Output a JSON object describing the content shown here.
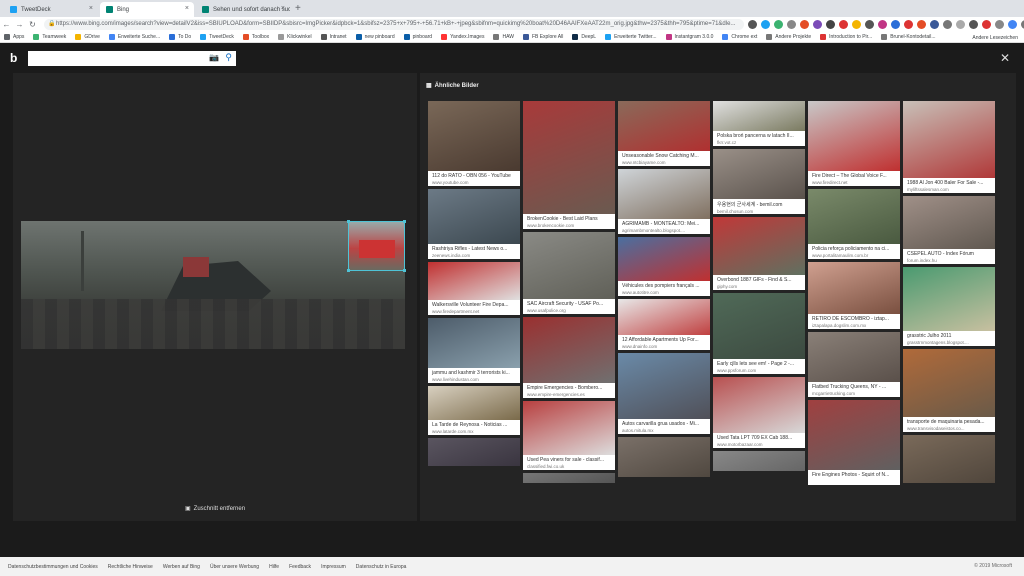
{
  "browser": {
    "tabs": [
      {
        "title": "TweetDeck",
        "color": "#1da1f2",
        "active": false
      },
      {
        "title": "Bing",
        "color": "#008373",
        "active": true
      },
      {
        "title": "Sehen und sofort danach suche...",
        "color": "#008373",
        "active": false
      }
    ],
    "url": "https://www.bing.com/images/search?view=detailV2&iss=SBIUPLOAD&form=SBIIDP&sbisrc=ImgPicker&idpbck=1&sbifsz=2375+x+795+-+56.71+kB+-+jpeg&sbifnm=quickimg%20boat%20D46AAIFXeAAT22m_orig.jpg&thw=2375&thh=795&ptime=71&dle...",
    "bookmarks": [
      {
        "label": "Apps",
        "color": "#5f6368"
      },
      {
        "label": "Teamweek",
        "color": "#3cb371"
      },
      {
        "label": "GDrive",
        "color": "#f4b400"
      },
      {
        "label": "Erweiterte Suche...",
        "color": "#4285f4"
      },
      {
        "label": "To Do",
        "color": "#2a6ed8"
      },
      {
        "label": "TweetDeck",
        "color": "#1da1f2"
      },
      {
        "label": "Toolbox",
        "color": "#e44d26"
      },
      {
        "label": "Klickwinkel",
        "color": "#999999"
      },
      {
        "label": "Intranet",
        "color": "#555555"
      },
      {
        "label": "new pinboard",
        "color": "#0a5ea8"
      },
      {
        "label": "pinboard",
        "color": "#0a5ea8"
      },
      {
        "label": "Yandex.Images",
        "color": "#ff3333"
      },
      {
        "label": "HAW",
        "color": "#777777"
      },
      {
        "label": "FB Explore All",
        "color": "#3b5998"
      },
      {
        "label": "DeepL",
        "color": "#0f2b46"
      },
      {
        "label": "Erweiterte Twitter...",
        "color": "#1da1f2"
      },
      {
        "label": "Instantgram 3.0.0",
        "color": "#c13584"
      },
      {
        "label": "Chrome ext",
        "color": "#4285f4"
      },
      {
        "label": "Andere Projekte",
        "color": "#777777"
      },
      {
        "label": "Introduction to Pir...",
        "color": "#d33"
      },
      {
        "label": "Brunel-Kontodetail...",
        "color": "#777777"
      }
    ],
    "bookmarks_other": "Andere Lesezeichen"
  },
  "bing": {
    "logo": "b",
    "search_value": "",
    "similar_title": "Ähnliche Bilder",
    "remove_crop": "Zuschnitt entfernen"
  },
  "columns": [
    {
      "cards": [
        {
          "caption": "112 do RATO - OBN 056 - YouTube",
          "source": "www.youtube.com",
          "thumb": [
            "#7a6858",
            "#4a3a30"
          ],
          "h": 70
        },
        {
          "caption": "Rashtriya Rifles - Latest News o...",
          "source": "zeenews.india.com",
          "thumb": [
            "#6c7a86",
            "#3c4850"
          ],
          "h": 55
        },
        {
          "caption": "Walkersville Volunteer Fire Depa...",
          "source": "www.firedepartment.net",
          "thumb": [
            "#c03030",
            "#e0e0e0"
          ],
          "h": 38
        },
        {
          "caption": "jammu and kashmir 3 terrorists ki...",
          "source": "www.livehindustan.com",
          "thumb": [
            "#4d5c6a",
            "#8aa0ad"
          ],
          "h": 50
        },
        {
          "caption": "La Tarde de Reynosa - Noticias ...",
          "source": "www.latarde.com.mx",
          "thumb": [
            "#d8d0c0",
            "#7a6a4a"
          ],
          "h": 34
        },
        {
          "caption": "",
          "source": "",
          "thumb": [
            "#5a5560",
            "#3a3540"
          ],
          "h": 28
        }
      ]
    },
    {
      "cards": [
        {
          "caption": "BrokenCookie - Best Laid Plans",
          "source": "www.brokencookie.com",
          "thumb": [
            "#a83a3a",
            "#6a5a50"
          ],
          "h": 113
        },
        {
          "caption": "SAC Aircraft Security - USAF Po...",
          "source": "www.usafpolice.org",
          "thumb": [
            "#8a8a85",
            "#606058"
          ],
          "h": 67
        },
        {
          "caption": "Empire Emergencies - Bombero...",
          "source": "www.empire-emergencies.es",
          "thumb": [
            "#9a3030",
            "#707070"
          ],
          "h": 66
        },
        {
          "caption": "Used Pea viners for sale - classif...",
          "source": "classified.fwi.co.uk",
          "thumb": [
            "#b84040",
            "#dddddd"
          ],
          "h": 54
        },
        {
          "caption": "",
          "source": "",
          "thumb": [
            "#777",
            "#555"
          ],
          "h": 10
        }
      ]
    },
    {
      "cards": [
        {
          "caption": "Unseasonable Snow Catching M...",
          "source": "www.ntcbiayame.com",
          "thumb": [
            "#8a6a5a",
            "#b03030"
          ],
          "h": 50
        },
        {
          "caption": "AGRIMAMB - MONTEALTO: Mei...",
          "source": "agrimambmontealto.blogspot....",
          "thumb": [
            "#cfd4d8",
            "#807060"
          ],
          "h": 50
        },
        {
          "caption": "Véhicules des pompiers françals ...",
          "source": "www.autotitre.com",
          "thumb": [
            "#4a6fa0",
            "#c03030"
          ],
          "h": 44
        },
        {
          "caption": "12 Affordable Apartments Up For...",
          "source": "www.dnainfo.com",
          "thumb": [
            "#e8e8e8",
            "#c04040"
          ],
          "h": 36
        },
        {
          "caption": "Autos carvarilla grua usados - Mi...",
          "source": "autos.mitula.mx",
          "thumb": [
            "#6a8aa8",
            "#505058"
          ],
          "h": 66
        },
        {
          "caption": "",
          "source": "",
          "thumb": [
            "#7a7068",
            "#504840"
          ],
          "h": 40
        }
      ]
    },
    {
      "cards": [
        {
          "caption": "Polska broń pancerna w latach II...",
          "source": "fkrr.vot.cz",
          "thumb": [
            "#e0e0e0",
            "#7a7a60"
          ],
          "h": 30
        },
        {
          "caption": "우용현의 군사세계 - bemil.com",
          "source": "bemil.chosun.com",
          "thumb": [
            "#9a9088",
            "#5a524c"
          ],
          "h": 50
        },
        {
          "caption": "Overbond 1887 GIFs - Find & S...",
          "source": "giphy.com",
          "thumb": [
            "#c03838",
            "#607060"
          ],
          "h": 58
        },
        {
          "caption": "Early cjlls lets see em! - Page 2 -...",
          "source": "www.ppsforum.com",
          "thumb": [
            "#506a58",
            "#3c4a40"
          ],
          "h": 66
        },
        {
          "caption": "Used Tata LPT 709 EX Cab 188...",
          "source": "www.motorbazaar.com",
          "thumb": [
            "#b85050",
            "#d8d8d8"
          ],
          "h": 56
        },
        {
          "caption": "",
          "source": "",
          "thumb": [
            "#888",
            "#666"
          ],
          "h": 20
        }
      ]
    },
    {
      "cards": [
        {
          "caption": "Fire Direct – The Global Voice F...",
          "source": "www.firedirect.net",
          "thumb": [
            "#c8c8c8",
            "#c03030"
          ],
          "h": 70
        },
        {
          "caption": "Policia reforça policiamento na ci...",
          "source": "www.portalitamaulim.com.br",
          "thumb": [
            "#7a8a6a",
            "#4a5a40"
          ],
          "h": 55
        },
        {
          "caption": "RETIRO DE ESCOMBRO - iztap...",
          "source": "iztapalapa.dogslim.com.mx",
          "thumb": [
            "#d0a090",
            "#7a5040"
          ],
          "h": 52
        },
        {
          "caption": "Flatbed Trucking Queens, NY - ...",
          "source": "mcgarrietrucking.com",
          "thumb": [
            "#8a8078",
            "#5a504a"
          ],
          "h": 50
        },
        {
          "caption": "Fire Engines Photos - Squirt of N...",
          "source": "",
          "thumb": [
            "#a04040",
            "#606060"
          ],
          "h": 70
        }
      ]
    },
    {
      "cards": [
        {
          "caption": "1988 Al Jon 400 Baler For Sale -...",
          "source": "myliftssalesman.com",
          "thumb": [
            "#c8c0b8",
            "#b03838"
          ],
          "h": 77
        },
        {
          "caption": "CSEPEL AUTO - Index Fórum",
          "source": "forum.index.hu",
          "thumb": [
            "#a09088",
            "#605850"
          ],
          "h": 53
        },
        {
          "caption": "grasstric Julho 2011",
          "source": "grasstrnmontagens.blogspot....",
          "thumb": [
            "#4a9a70",
            "#c8c0a0"
          ],
          "h": 64
        },
        {
          "caption": "transporte de maquinaria pesada...",
          "source": "www.transvisodaseistos.co...",
          "thumb": [
            "#b06a3a",
            "#6a5a48"
          ],
          "h": 68
        },
        {
          "caption": "",
          "source": "",
          "thumb": [
            "#7a6a5a",
            "#50463c"
          ],
          "h": 48
        }
      ]
    }
  ],
  "footer": {
    "links": [
      "Datenschutzbestimmungen und Cookies",
      "Rechtliche Hinweise",
      "Werben auf Bing",
      "Über unsere Werbung",
      "Hilfe",
      "Feedback",
      "Impressum",
      "Datenschutz in Europa"
    ],
    "copyright": "© 2019 Microsoft"
  }
}
